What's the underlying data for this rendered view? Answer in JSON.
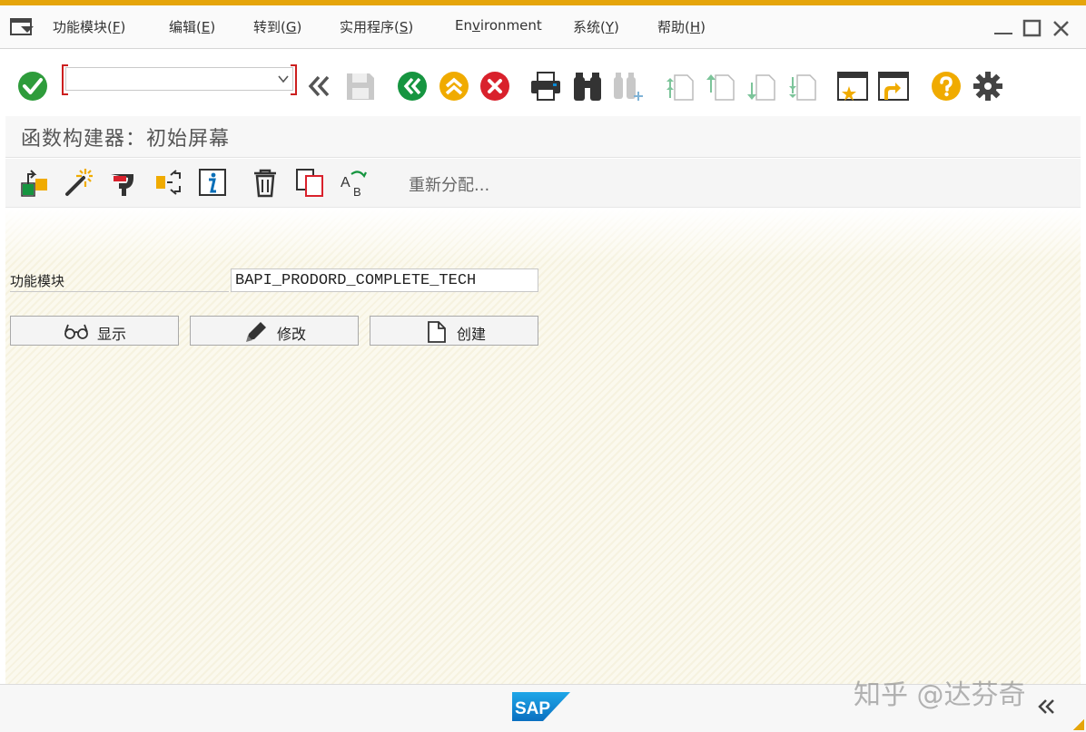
{
  "menubar": {
    "items": [
      {
        "label": "功能模块(",
        "mnemonic": "F",
        "suffix": ")"
      },
      {
        "label": "编辑(",
        "mnemonic": "E",
        "suffix": ")"
      },
      {
        "label": "转到(",
        "mnemonic": "G",
        "suffix": ")"
      },
      {
        "label": "实用程序(",
        "mnemonic": "S",
        "suffix": ")"
      },
      {
        "label": "En",
        "mnemonic": "v",
        "suffix": "ironment"
      },
      {
        "label": "系统(",
        "mnemonic": "Y",
        "suffix": ")"
      },
      {
        "label": "帮助(",
        "mnemonic": "H",
        "suffix": ")"
      }
    ]
  },
  "command_field": {
    "value": ""
  },
  "page": {
    "title": "函数构建器：初始屏幕"
  },
  "app_toolbar": {
    "reassign_label": "重新分配..."
  },
  "form": {
    "function_module_label": "功能模块",
    "function_module_value": "BAPI_PRODORD_COMPLETE_TECH",
    "display_label": "显示",
    "change_label": "修改",
    "create_label": "创建"
  },
  "status": {
    "sap_logo_text": "SAP",
    "watermark": "知乎 @达芬奇"
  },
  "icons": [
    "menu-icon",
    "minimize-icon",
    "maximize-icon",
    "close-icon",
    "enter-icon",
    "dropdown-icon",
    "expand-icon",
    "save-icon",
    "back-icon",
    "exit-icon",
    "cancel-icon",
    "print-icon",
    "find-icon",
    "find-next-icon",
    "first-page-icon",
    "previous-page-icon",
    "next-page-icon",
    "last-page-icon",
    "new-session-icon",
    "shortcut-icon",
    "help-icon",
    "settings-icon",
    "other-object-icon",
    "wizard-icon",
    "where-used-icon",
    "where-used-list-icon",
    "info-icon",
    "delete-icon",
    "copy-icon",
    "rename-icon",
    "glasses-icon",
    "pencil-icon",
    "document-icon",
    "collapse-icon"
  ],
  "colors": {
    "top_bar": "#e5a50a",
    "enter_green": "#2e9c3b",
    "back_green": "#169540",
    "exit_yellow": "#f0ab00",
    "cancel_red": "#d9212c",
    "help_orange": "#f0ab00",
    "sap_blue": "#0a8ad6"
  }
}
